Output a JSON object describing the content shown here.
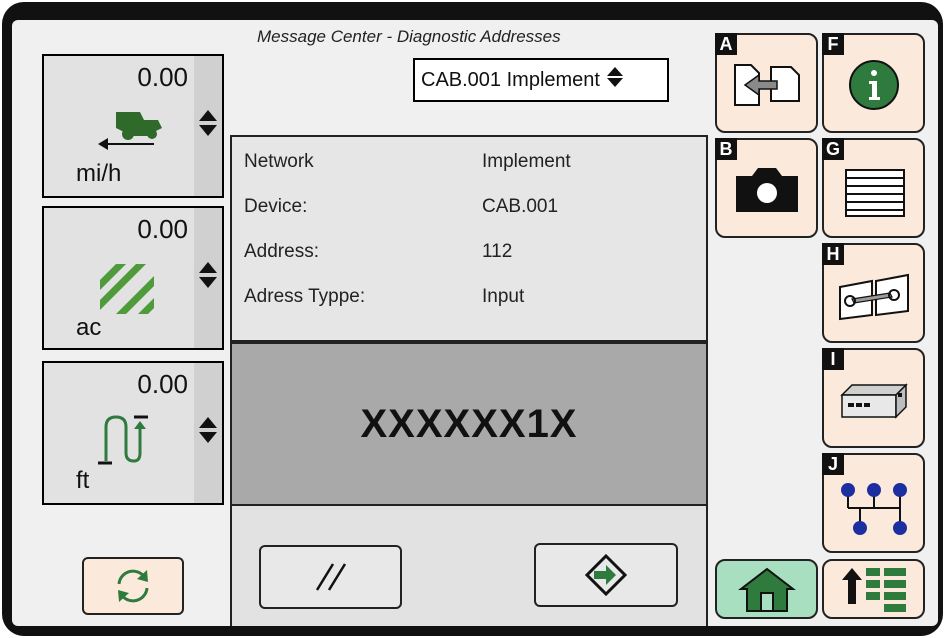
{
  "header": {
    "title": "Message Center - Diagnostic Addresses",
    "selector_value": "CAB.001 Implement"
  },
  "gauges": [
    {
      "value": "0.00",
      "unit": "mi/h",
      "icon": "tractor-speed-icon"
    },
    {
      "value": "0.00",
      "unit": "ac",
      "icon": "area-icon"
    },
    {
      "value": "0.00",
      "unit": "ft",
      "icon": "implement-height-icon"
    }
  ],
  "details": {
    "rows": [
      {
        "label": "Network",
        "value": "Implement"
      },
      {
        "label": "Device:",
        "value": "CAB.001"
      },
      {
        "label": "Address:",
        "value": "112"
      },
      {
        "label": "Adress Typpe:",
        "value": "Input"
      }
    ]
  },
  "readout": {
    "value": "XXXXXX1X"
  },
  "softkeys": {
    "A": {
      "letter": "A",
      "icon": "transfer-document-icon"
    },
    "B": {
      "letter": "B",
      "icon": "camera-icon"
    },
    "F": {
      "letter": "F",
      "icon": "info-icon"
    },
    "G": {
      "letter": "G",
      "icon": "list-icon"
    },
    "H": {
      "letter": "H",
      "icon": "service-manual-icon"
    },
    "I": {
      "letter": "I",
      "icon": "controller-unit-icon"
    },
    "J": {
      "letter": "J",
      "icon": "network-diagram-icon"
    }
  },
  "colors": {
    "softkey_bg": "#fbeadb",
    "home_bg": "#a8dfc0",
    "accent_green": "#2f7a3d",
    "network_blue": "#1c2fa0"
  }
}
